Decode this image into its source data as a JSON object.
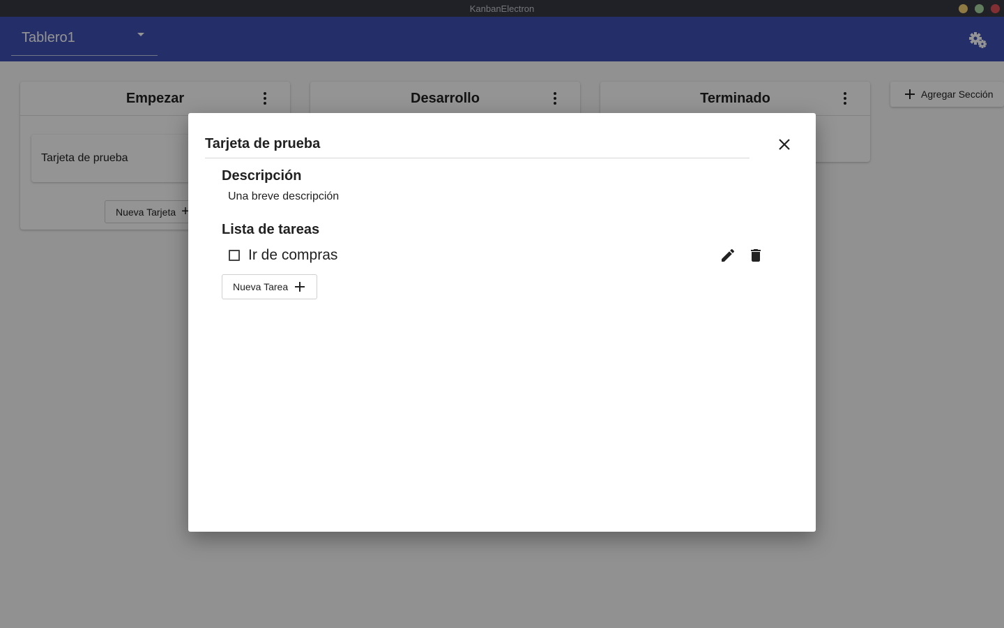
{
  "window": {
    "title": "KanbanElectron"
  },
  "appbar": {
    "board_selected": "Tablero1"
  },
  "board": {
    "columns": [
      {
        "title": "Empezar",
        "cards": [
          {
            "title": "Tarjeta de prueba"
          }
        ],
        "new_card_label": "Nueva Tarjeta"
      },
      {
        "title": "Desarrollo"
      },
      {
        "title": "Terminado"
      }
    ],
    "add_section_label": "Agregar Sección"
  },
  "dialog": {
    "title": "Tarjeta de prueba",
    "description_heading": "Descripción",
    "description_text": "Una breve descripción",
    "tasks_heading": "Lista de tareas",
    "tasks": [
      {
        "label": "Ir de compras",
        "checked": false
      }
    ],
    "new_task_label": "Nueva Tarea"
  },
  "colors": {
    "appbar": "#3f51b5",
    "titlebar": "#373a44"
  },
  "icons": [
    "settings-icon",
    "kebab-icon",
    "plus-icon",
    "close-icon",
    "edit-icon",
    "delete-icon",
    "dropdown-caret-icon"
  ]
}
